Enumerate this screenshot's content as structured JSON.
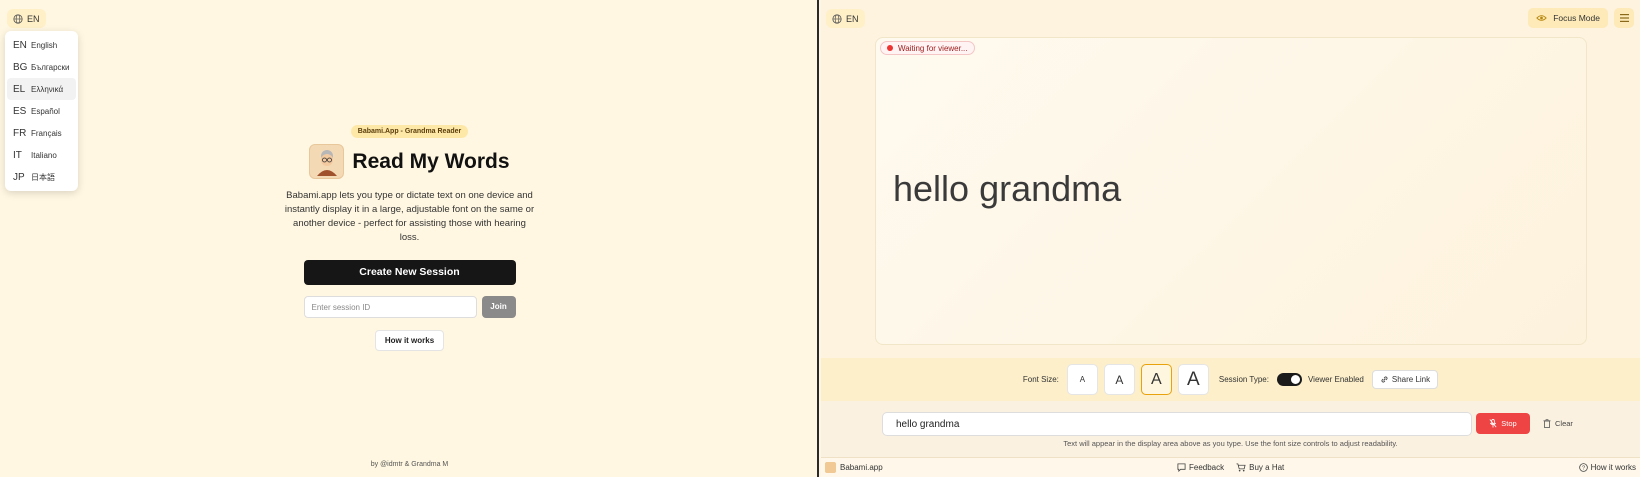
{
  "left": {
    "lang_button": "EN",
    "languages": [
      {
        "code": "EN",
        "name": "English"
      },
      {
        "code": "BG",
        "name": "Български"
      },
      {
        "code": "EL",
        "name": "Ελληνικά"
      },
      {
        "code": "ES",
        "name": "Español"
      },
      {
        "code": "FR",
        "name": "Français"
      },
      {
        "code": "IT",
        "name": "Italiano"
      },
      {
        "code": "JP",
        "name": "日本語"
      }
    ],
    "badge": "Babami.App - Grandma Reader",
    "title": "Read My Words",
    "description": "Babami.app lets you type or dictate text on one device and instantly display it in a large, adjustable font on the same or another device - perfect for assisting those with hearing loss.",
    "create_button": "Create New Session",
    "session_placeholder": "Enter session ID",
    "join_button": "Join",
    "how_button": "How it works",
    "credits": "by @idmtr & Grandma M"
  },
  "right": {
    "lang_button": "EN",
    "focus_mode": "Focus Mode",
    "status": "Waiting for viewer...",
    "display_text": "hello grandma",
    "font_size_label": "Font Size:",
    "font_sizes": [
      "A",
      "A",
      "A",
      "A"
    ],
    "active_font_size_index": 2,
    "session_type_label": "Session Type:",
    "viewer_label": "Viewer Enabled",
    "share_label": "Share Link",
    "input_value": "hello grandma",
    "stop_label": "Stop",
    "clear_label": "Clear",
    "hint": "Text will appear in the display area above as you type. Use the font size controls to adjust readability.",
    "footer": {
      "brand": "Babami.app",
      "feedback": "Feedback",
      "buy": "Buy a Hat",
      "how": "How it works"
    }
  },
  "colors": {
    "accent_red": "#ef4444",
    "active_outline": "#e8a20c",
    "primary_dark": "#161616"
  }
}
